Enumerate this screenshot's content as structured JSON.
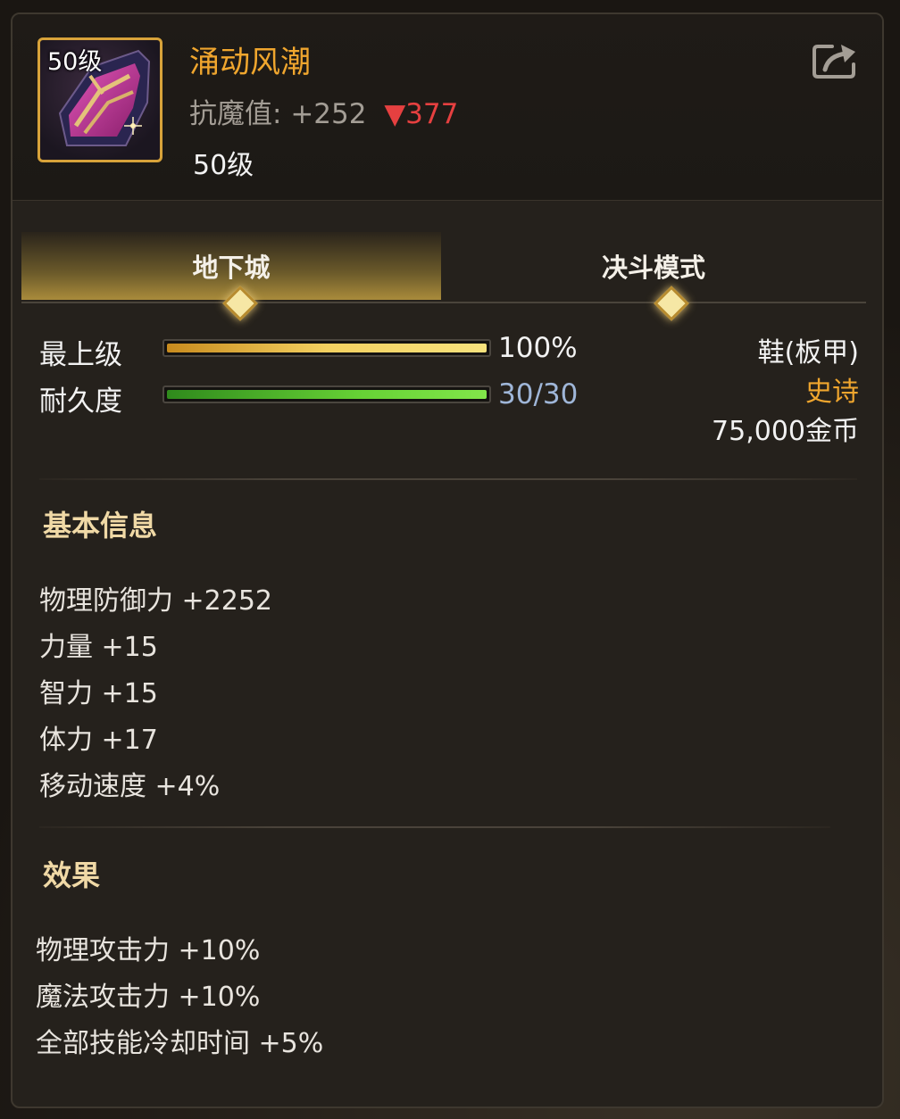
{
  "item": {
    "icon_level": "50级",
    "name": "涌动风潮",
    "stat_label": "抗魔值:",
    "stat_value": "+252",
    "stat_diff": "▼377",
    "level_text": "50级"
  },
  "tabs": [
    {
      "label": "地下城",
      "active": true
    },
    {
      "label": "决斗模式",
      "active": false
    }
  ],
  "bars": {
    "grade": {
      "label": "最上级",
      "value_text": "100%",
      "fill": 1.0
    },
    "durability": {
      "label": "耐久度",
      "value_text": "30/30",
      "fill": 1.0
    }
  },
  "item_info": {
    "type": "鞋(板甲)",
    "rarity": "史诗",
    "price": "75,000金币"
  },
  "basic_info": {
    "title": "基本信息",
    "stats": [
      "物理防御力 +2252",
      "力量 +15",
      "智力 +15",
      "体力 +17",
      "移动速度 +4%"
    ]
  },
  "effects": {
    "title": "效果",
    "stats": [
      "物理攻击力 +10%",
      "魔法攻击力 +10%",
      "全部技能冷却时间 +5%"
    ]
  },
  "colors": {
    "item_name": "#f0a62e",
    "rarity": "#f0a62e",
    "decrease": "#e64040",
    "durability_text": "#9fb6d8"
  },
  "icons": {
    "share": "share-icon",
    "item": "boot-icon"
  }
}
